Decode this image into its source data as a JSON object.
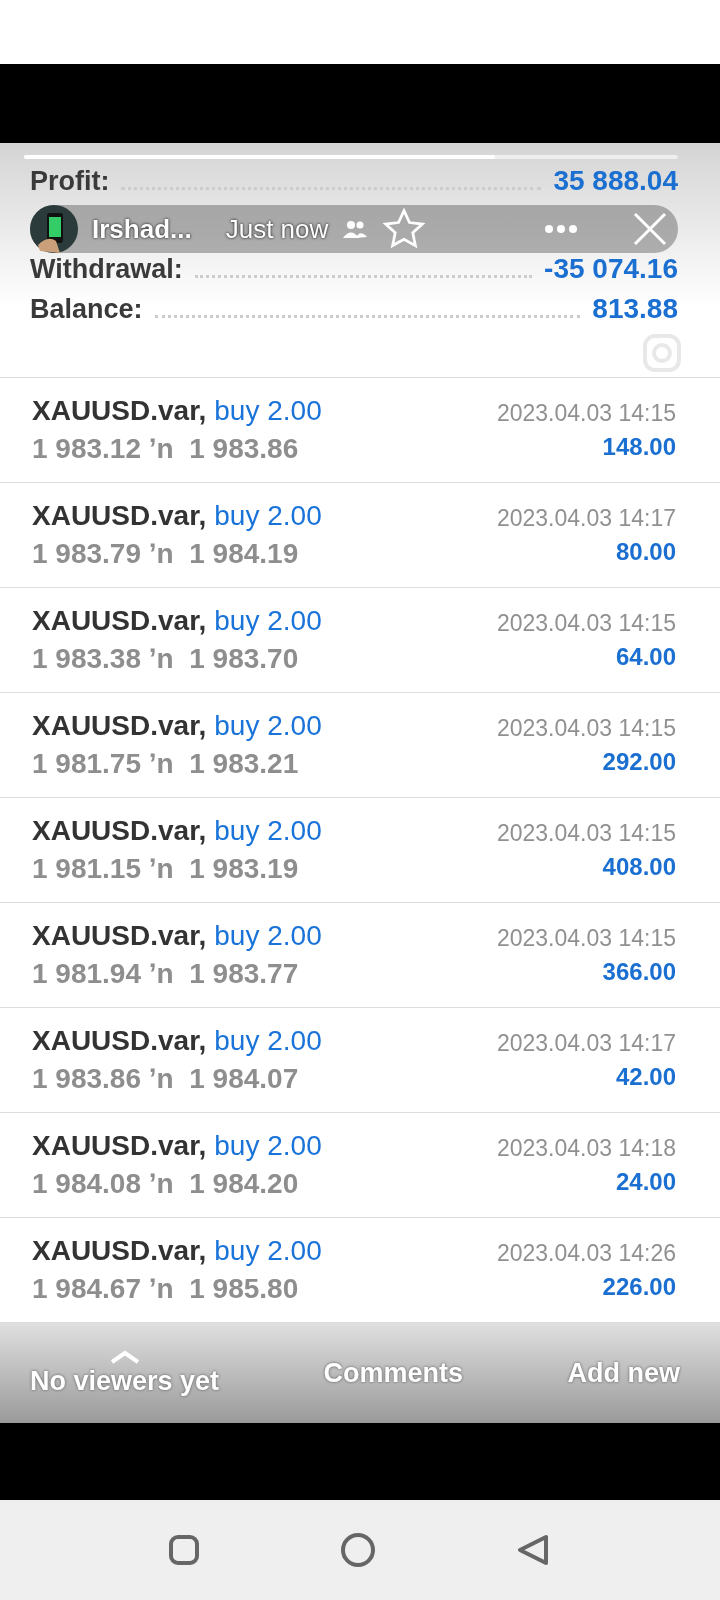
{
  "story": {
    "progress": {
      "level": 0.72
    },
    "author": "Irshad...",
    "time": "Just now"
  },
  "summary": [
    {
      "label": "Profit:",
      "value": "35 888.04"
    },
    {
      "label": "Withdrawal:",
      "value": "-35 074.16"
    },
    {
      "label": "Balance:",
      "value": "813.88"
    }
  ],
  "deals": [
    {
      "symbol": "XAUUSD.var,",
      "side": "buy 2.00",
      "prices": "1 983.12 ʼn  1 983.86",
      "time": "2023.04.03 14:15",
      "profit": "148.00"
    },
    {
      "symbol": "XAUUSD.var,",
      "side": "buy 2.00",
      "prices": "1 983.79 ʼn  1 984.19",
      "time": "2023.04.03 14:17",
      "profit": "80.00"
    },
    {
      "symbol": "XAUUSD.var,",
      "side": "buy 2.00",
      "prices": "1 983.38 ʼn  1 983.70",
      "time": "2023.04.03 14:15",
      "profit": "64.00"
    },
    {
      "symbol": "XAUUSD.var,",
      "side": "buy 2.00",
      "prices": "1 981.75 ʼn  1 983.21",
      "time": "2023.04.03 14:15",
      "profit": "292.00"
    },
    {
      "symbol": "XAUUSD.var,",
      "side": "buy 2.00",
      "prices": "1 981.15 ʼn  1 983.19",
      "time": "2023.04.03 14:15",
      "profit": "408.00"
    },
    {
      "symbol": "XAUUSD.var,",
      "side": "buy 2.00",
      "prices": "1 981.94 ʼn  1 983.77",
      "time": "2023.04.03 14:15",
      "profit": "366.00"
    },
    {
      "symbol": "XAUUSD.var,",
      "side": "buy 2.00",
      "prices": "1 983.86 ʼn  1 984.07",
      "time": "2023.04.03 14:17",
      "profit": "42.00"
    },
    {
      "symbol": "XAUUSD.var,",
      "side": "buy 2.00",
      "prices": "1 984.08 ʼn  1 984.20",
      "time": "2023.04.03 14:18",
      "profit": "24.00"
    },
    {
      "symbol": "XAUUSD.var,",
      "side": "buy 2.00",
      "prices": "1 984.67 ʼn  1 985.80",
      "time": "2023.04.03 14:26",
      "profit": "226.00"
    }
  ],
  "footer": {
    "viewers": "No viewers yet",
    "comments": "Comments",
    "add": "Add new"
  }
}
